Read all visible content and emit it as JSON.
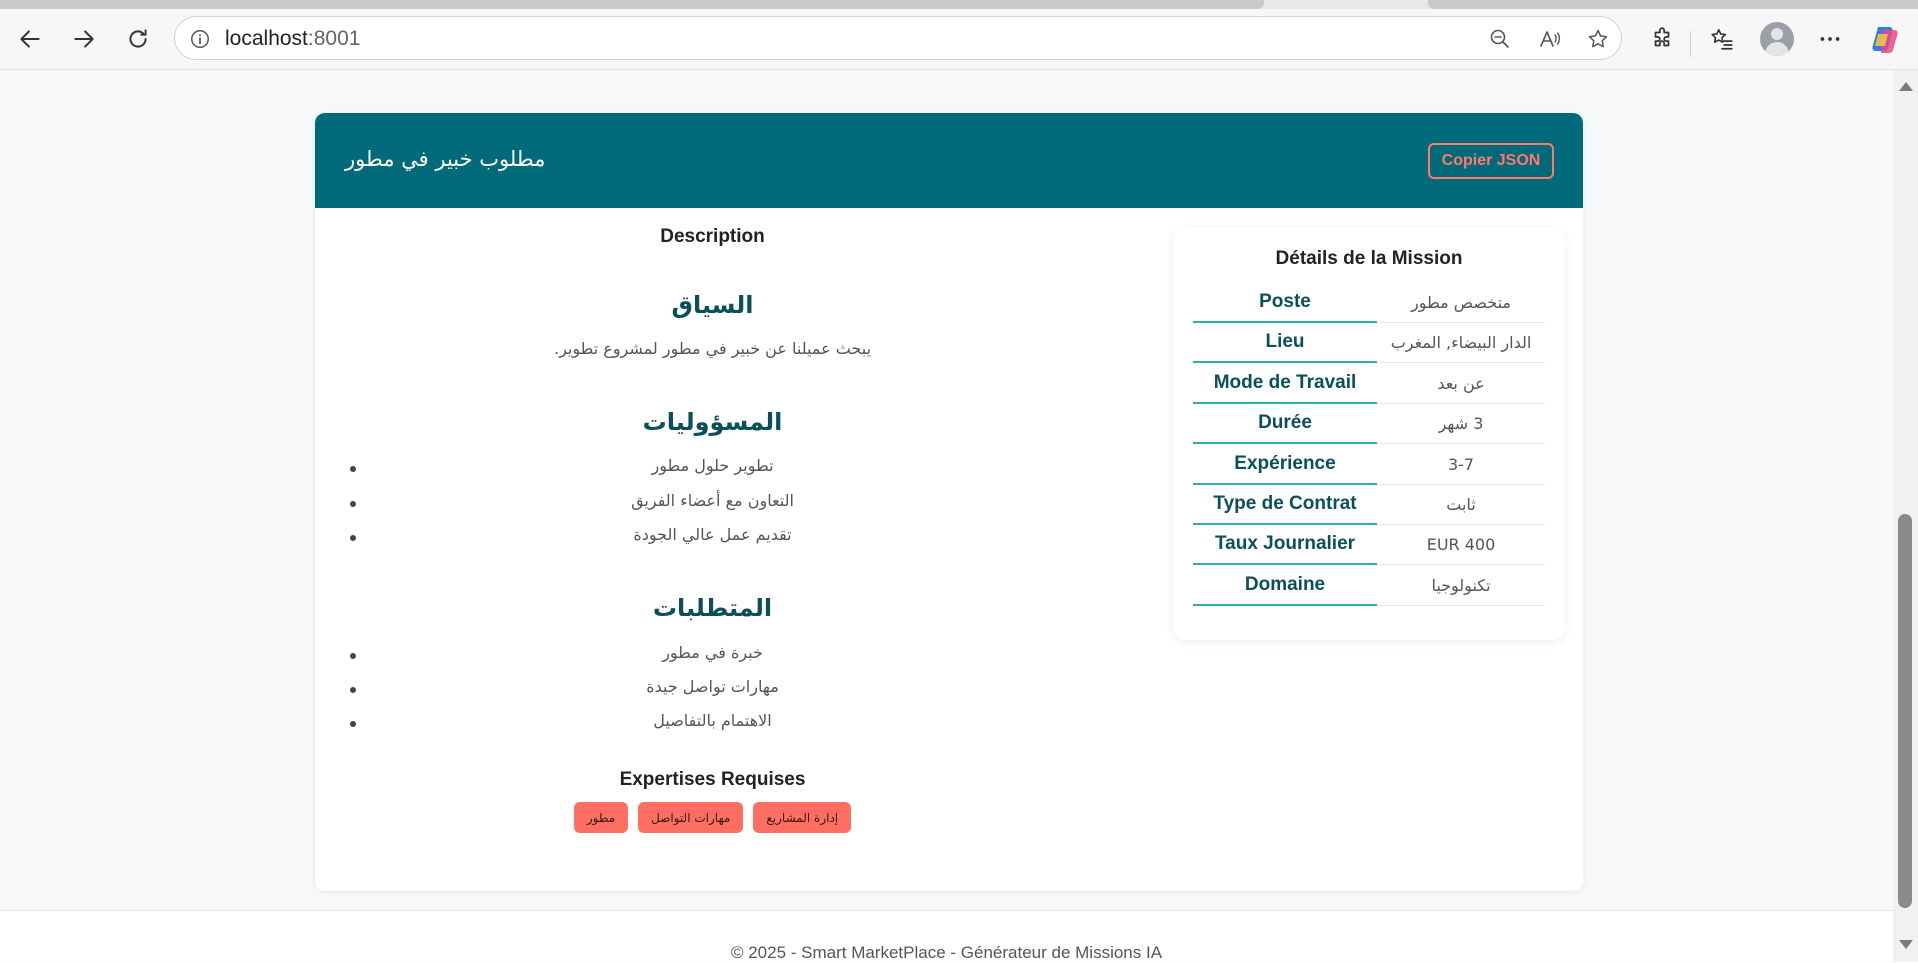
{
  "browser": {
    "url_host": "localhost",
    "url_port": ":8001"
  },
  "mission": {
    "title": "مطلوب خبير في مطور",
    "copy_button": "Copier JSON",
    "description_title": "Description",
    "context_heading": "السياق",
    "context_text": "يبحث عميلنا عن خبير في مطور لمشروع تطوير.",
    "responsibilities_heading": "المسؤوليات",
    "responsibilities": [
      "تطوير حلول مطور",
      "التعاون مع أعضاء الفريق",
      "تقديم عمل عالي الجودة"
    ],
    "requirements_heading": "المتطلبات",
    "requirements": [
      "خبرة في مطور",
      "مهارات تواصل جيدة",
      "الاهتمام بالتفاصيل"
    ],
    "expertises_title": "Expertises Requises",
    "expertises": [
      "مطور",
      "مهارات التواصل",
      "إدارة المشاريع"
    ]
  },
  "details": {
    "title": "Détails de la Mission",
    "rows": [
      {
        "label": "Poste",
        "value": "متخصص مطور"
      },
      {
        "label": "Lieu",
        "value": "الدار البيضاء, المغرب"
      },
      {
        "label": "Mode de Travail",
        "value": "عن بعد"
      },
      {
        "label": "Durée",
        "value": "3 شهر"
      },
      {
        "label": "Expérience",
        "value": "3-7"
      },
      {
        "label": "Type de Contrat",
        "value": "ثابت"
      },
      {
        "label": "Taux Journalier",
        "value": "400 EUR"
      },
      {
        "label": "Domaine",
        "value": "تكنولوجيا"
      }
    ]
  },
  "footer": {
    "text": "© 2025 - Smart MarketPlace - Générateur de Missions IA"
  }
}
